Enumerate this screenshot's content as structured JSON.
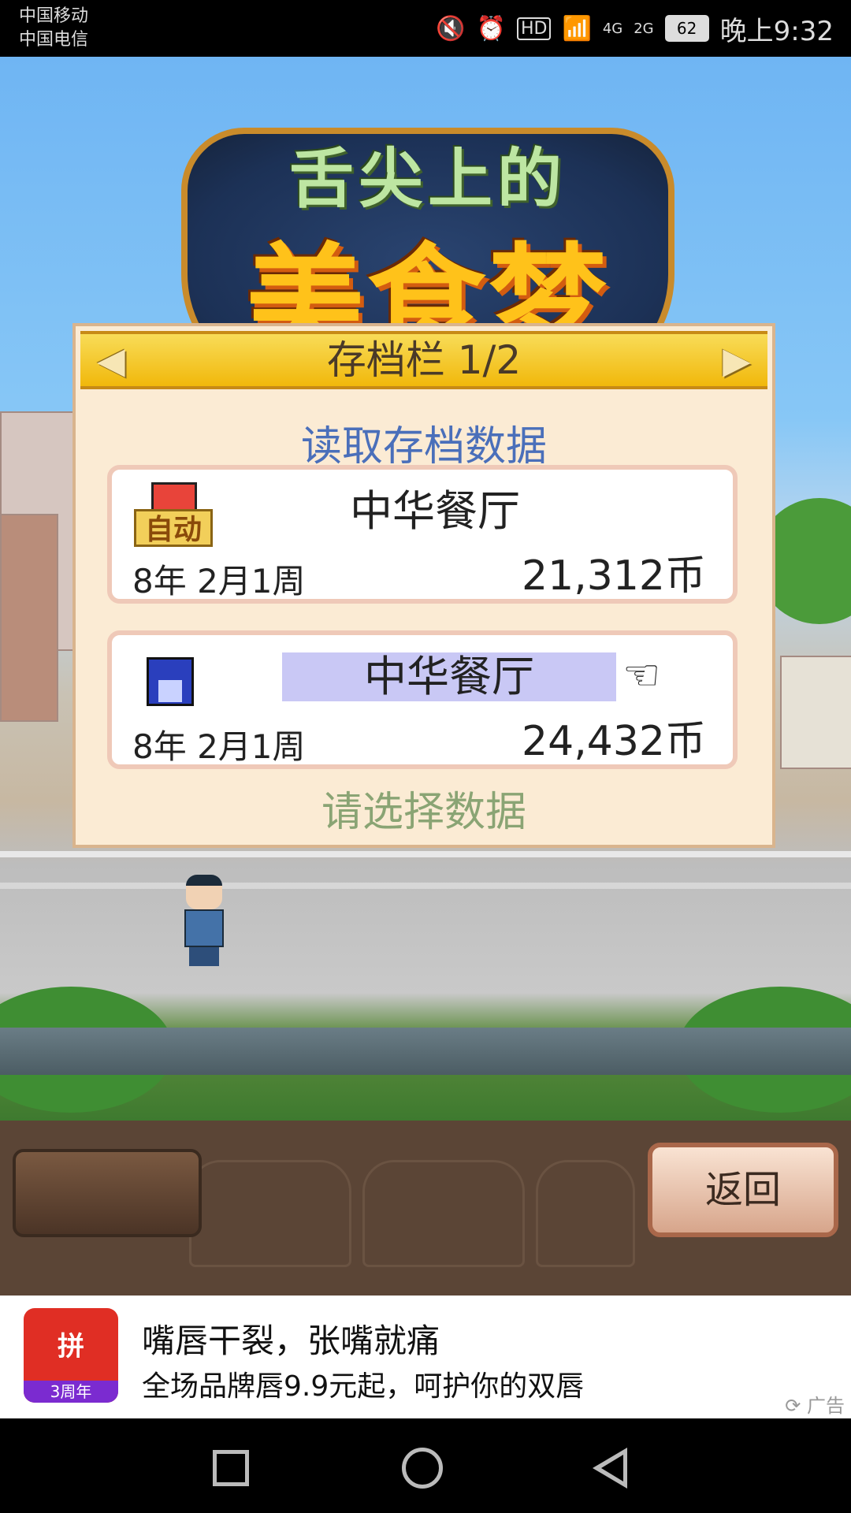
{
  "status_bar": {
    "carrier1": "中国移动",
    "carrier2": "中国电信",
    "hd": "HD",
    "net4g": "4G",
    "net2g": "2G",
    "battery": "62",
    "time": "晚上9:32"
  },
  "dialog": {
    "title": "存档栏 1/2",
    "subtitle": "读取存档数据",
    "hint": "请选择数据",
    "slots": [
      {
        "icon": "auto-save-icon",
        "auto_label": "自动",
        "name": "中华餐厅",
        "date": "8年 2月1周",
        "coins": "21,312币"
      },
      {
        "icon": "floppy-disk-icon",
        "name": "中华餐厅",
        "date": "8年 2月1周",
        "coins": "24,432币"
      }
    ]
  },
  "game_bar": {
    "back_label": "返回"
  },
  "ad": {
    "logo_mark": "拼",
    "logo_years": "3周年",
    "title": "嘴唇干裂，张嘴就痛",
    "description": "全场品牌唇9.9元起，呵护你的双唇",
    "tag": "广告"
  },
  "colors": {
    "header_gold": "#f1b80b",
    "subtitle_blue": "#4a6fba",
    "hint_green": "#8aa474",
    "highlight": "#c9c8f5"
  }
}
